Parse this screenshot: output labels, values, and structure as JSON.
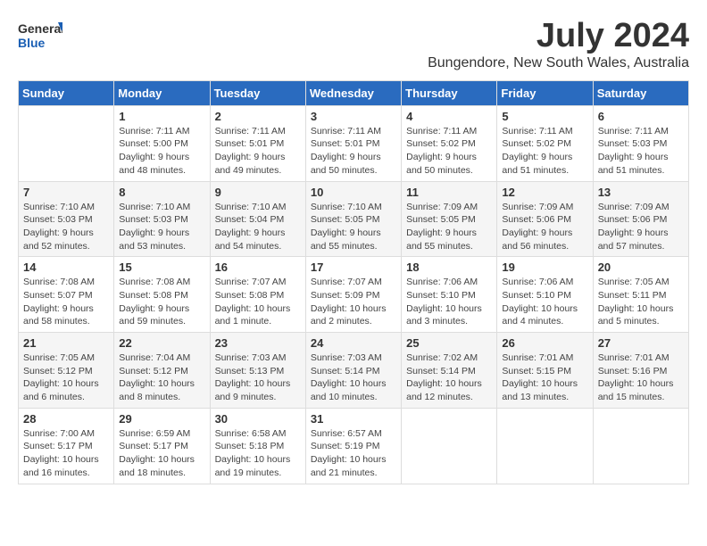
{
  "logo": {
    "line1": "General",
    "line2": "Blue"
  },
  "title": "July 2024",
  "subtitle": "Bungendore, New South Wales, Australia",
  "days_of_week": [
    "Sunday",
    "Monday",
    "Tuesday",
    "Wednesday",
    "Thursday",
    "Friday",
    "Saturday"
  ],
  "weeks": [
    [
      {
        "day": "",
        "sunrise": "",
        "sunset": "",
        "daylight": ""
      },
      {
        "day": "1",
        "sunrise": "Sunrise: 7:11 AM",
        "sunset": "Sunset: 5:00 PM",
        "daylight": "Daylight: 9 hours and 48 minutes."
      },
      {
        "day": "2",
        "sunrise": "Sunrise: 7:11 AM",
        "sunset": "Sunset: 5:01 PM",
        "daylight": "Daylight: 9 hours and 49 minutes."
      },
      {
        "day": "3",
        "sunrise": "Sunrise: 7:11 AM",
        "sunset": "Sunset: 5:01 PM",
        "daylight": "Daylight: 9 hours and 50 minutes."
      },
      {
        "day": "4",
        "sunrise": "Sunrise: 7:11 AM",
        "sunset": "Sunset: 5:02 PM",
        "daylight": "Daylight: 9 hours and 50 minutes."
      },
      {
        "day": "5",
        "sunrise": "Sunrise: 7:11 AM",
        "sunset": "Sunset: 5:02 PM",
        "daylight": "Daylight: 9 hours and 51 minutes."
      },
      {
        "day": "6",
        "sunrise": "Sunrise: 7:11 AM",
        "sunset": "Sunset: 5:03 PM",
        "daylight": "Daylight: 9 hours and 51 minutes."
      }
    ],
    [
      {
        "day": "7",
        "sunrise": "Sunrise: 7:10 AM",
        "sunset": "Sunset: 5:03 PM",
        "daylight": "Daylight: 9 hours and 52 minutes."
      },
      {
        "day": "8",
        "sunrise": "Sunrise: 7:10 AM",
        "sunset": "Sunset: 5:03 PM",
        "daylight": "Daylight: 9 hours and 53 minutes."
      },
      {
        "day": "9",
        "sunrise": "Sunrise: 7:10 AM",
        "sunset": "Sunset: 5:04 PM",
        "daylight": "Daylight: 9 hours and 54 minutes."
      },
      {
        "day": "10",
        "sunrise": "Sunrise: 7:10 AM",
        "sunset": "Sunset: 5:05 PM",
        "daylight": "Daylight: 9 hours and 55 minutes."
      },
      {
        "day": "11",
        "sunrise": "Sunrise: 7:09 AM",
        "sunset": "Sunset: 5:05 PM",
        "daylight": "Daylight: 9 hours and 55 minutes."
      },
      {
        "day": "12",
        "sunrise": "Sunrise: 7:09 AM",
        "sunset": "Sunset: 5:06 PM",
        "daylight": "Daylight: 9 hours and 56 minutes."
      },
      {
        "day": "13",
        "sunrise": "Sunrise: 7:09 AM",
        "sunset": "Sunset: 5:06 PM",
        "daylight": "Daylight: 9 hours and 57 minutes."
      }
    ],
    [
      {
        "day": "14",
        "sunrise": "Sunrise: 7:08 AM",
        "sunset": "Sunset: 5:07 PM",
        "daylight": "Daylight: 9 hours and 58 minutes."
      },
      {
        "day": "15",
        "sunrise": "Sunrise: 7:08 AM",
        "sunset": "Sunset: 5:08 PM",
        "daylight": "Daylight: 9 hours and 59 minutes."
      },
      {
        "day": "16",
        "sunrise": "Sunrise: 7:07 AM",
        "sunset": "Sunset: 5:08 PM",
        "daylight": "Daylight: 10 hours and 1 minute."
      },
      {
        "day": "17",
        "sunrise": "Sunrise: 7:07 AM",
        "sunset": "Sunset: 5:09 PM",
        "daylight": "Daylight: 10 hours and 2 minutes."
      },
      {
        "day": "18",
        "sunrise": "Sunrise: 7:06 AM",
        "sunset": "Sunset: 5:10 PM",
        "daylight": "Daylight: 10 hours and 3 minutes."
      },
      {
        "day": "19",
        "sunrise": "Sunrise: 7:06 AM",
        "sunset": "Sunset: 5:10 PM",
        "daylight": "Daylight: 10 hours and 4 minutes."
      },
      {
        "day": "20",
        "sunrise": "Sunrise: 7:05 AM",
        "sunset": "Sunset: 5:11 PM",
        "daylight": "Daylight: 10 hours and 5 minutes."
      }
    ],
    [
      {
        "day": "21",
        "sunrise": "Sunrise: 7:05 AM",
        "sunset": "Sunset: 5:12 PM",
        "daylight": "Daylight: 10 hours and 6 minutes."
      },
      {
        "day": "22",
        "sunrise": "Sunrise: 7:04 AM",
        "sunset": "Sunset: 5:12 PM",
        "daylight": "Daylight: 10 hours and 8 minutes."
      },
      {
        "day": "23",
        "sunrise": "Sunrise: 7:03 AM",
        "sunset": "Sunset: 5:13 PM",
        "daylight": "Daylight: 10 hours and 9 minutes."
      },
      {
        "day": "24",
        "sunrise": "Sunrise: 7:03 AM",
        "sunset": "Sunset: 5:14 PM",
        "daylight": "Daylight: 10 hours and 10 minutes."
      },
      {
        "day": "25",
        "sunrise": "Sunrise: 7:02 AM",
        "sunset": "Sunset: 5:14 PM",
        "daylight": "Daylight: 10 hours and 12 minutes."
      },
      {
        "day": "26",
        "sunrise": "Sunrise: 7:01 AM",
        "sunset": "Sunset: 5:15 PM",
        "daylight": "Daylight: 10 hours and 13 minutes."
      },
      {
        "day": "27",
        "sunrise": "Sunrise: 7:01 AM",
        "sunset": "Sunset: 5:16 PM",
        "daylight": "Daylight: 10 hours and 15 minutes."
      }
    ],
    [
      {
        "day": "28",
        "sunrise": "Sunrise: 7:00 AM",
        "sunset": "Sunset: 5:17 PM",
        "daylight": "Daylight: 10 hours and 16 minutes."
      },
      {
        "day": "29",
        "sunrise": "Sunrise: 6:59 AM",
        "sunset": "Sunset: 5:17 PM",
        "daylight": "Daylight: 10 hours and 18 minutes."
      },
      {
        "day": "30",
        "sunrise": "Sunrise: 6:58 AM",
        "sunset": "Sunset: 5:18 PM",
        "daylight": "Daylight: 10 hours and 19 minutes."
      },
      {
        "day": "31",
        "sunrise": "Sunrise: 6:57 AM",
        "sunset": "Sunset: 5:19 PM",
        "daylight": "Daylight: 10 hours and 21 minutes."
      },
      {
        "day": "",
        "sunrise": "",
        "sunset": "",
        "daylight": ""
      },
      {
        "day": "",
        "sunrise": "",
        "sunset": "",
        "daylight": ""
      },
      {
        "day": "",
        "sunrise": "",
        "sunset": "",
        "daylight": ""
      }
    ]
  ]
}
